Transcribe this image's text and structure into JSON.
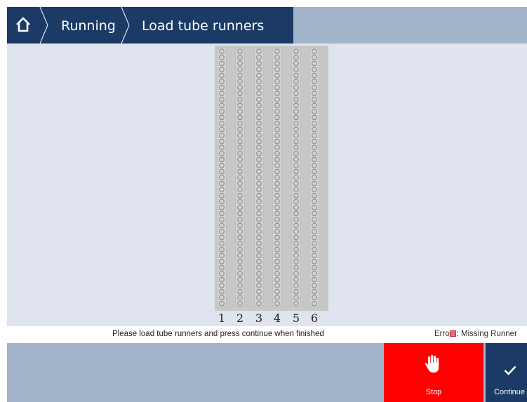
{
  "header": {
    "breadcrumb": [
      "Running",
      "Load tube runners"
    ],
    "home_icon": "home-icon"
  },
  "rack": {
    "runner_labels": [
      "1",
      "2",
      "3",
      "4",
      "5",
      "6"
    ],
    "positions_per_runner": 43,
    "slot_icon": "tube-slot-circle-icon"
  },
  "status": {
    "instruction": "Please load tube runners and press continue when finished",
    "errors_label": "Errors:",
    "legend_label": "Missing Runner",
    "legend_color": "#f06a6a"
  },
  "footer": {
    "stop_label": "Stop",
    "stop_icon": "hand-stop-icon",
    "continue_label": "Continue",
    "continue_icon": "checkmark-icon"
  },
  "colors": {
    "header_dark": "#1b3a66",
    "header_light": "#a2b4c9",
    "main_bg": "#e0e4ef",
    "stop_red": "#ff0000"
  }
}
